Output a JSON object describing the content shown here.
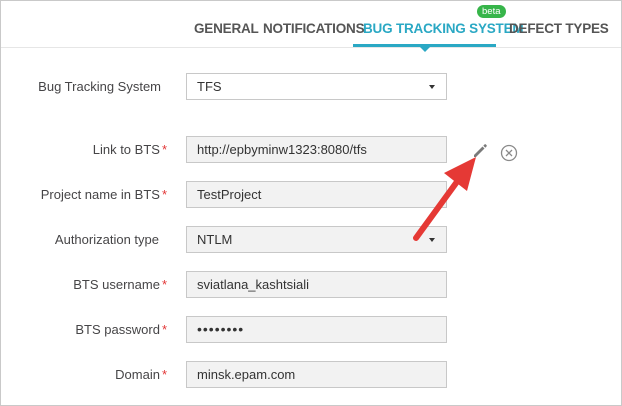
{
  "tabs": [
    {
      "label": "GENERAL",
      "active": false
    },
    {
      "label": "NOTIFICATIONS",
      "active": false
    },
    {
      "label": "BUG TRACKING SYSTEM",
      "active": true,
      "badge": "beta"
    },
    {
      "label": "DEFECT TYPES",
      "active": false
    }
  ],
  "form": {
    "bts": {
      "label": "Bug Tracking System",
      "value": "TFS"
    },
    "link": {
      "label": "Link to BTS",
      "required": "*",
      "value": "http://epbyminw1323:8080/tfs"
    },
    "project": {
      "label": "Project name in BTS",
      "required": "*",
      "value": "TestProject"
    },
    "auth": {
      "label": "Authorization type",
      "value": "NTLM"
    },
    "username": {
      "label": "BTS username",
      "required": "*",
      "value": "sviatlana_kashtsiali"
    },
    "password": {
      "label": "BTS password",
      "required": "*",
      "value": "••••••••"
    },
    "domain": {
      "label": "Domain",
      "required": "*",
      "value": "minsk.epam.com"
    }
  },
  "icons": {
    "edit": "pencil-icon",
    "clear": "circle-x-icon",
    "annotation": "red-arrow"
  },
  "colors": {
    "accent": "#2aa8c4",
    "badge": "#37b54a",
    "required": "#e23636",
    "arrow": "#e53935"
  }
}
